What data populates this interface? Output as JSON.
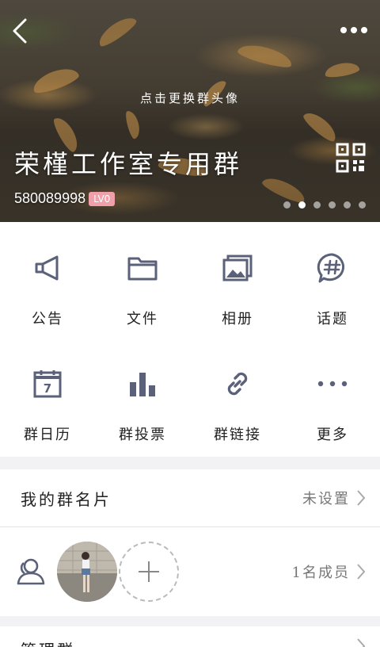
{
  "header": {
    "change_avatar_label": "点击更换群头像",
    "group_name": "荣槿工作室专用群",
    "group_id": "580089998",
    "level_badge": "LV0",
    "more_icon": "more-horizontal-icon",
    "back_icon": "back-arrow-icon",
    "qr_icon": "qr-code-icon",
    "page_dots": 6,
    "active_dot": 1
  },
  "grid": [
    {
      "label": "公告",
      "icon": "announcement-icon"
    },
    {
      "label": "文件",
      "icon": "folder-icon"
    },
    {
      "label": "相册",
      "icon": "album-icon"
    },
    {
      "label": "话题",
      "icon": "topic-icon"
    },
    {
      "label": "群日历",
      "icon": "calendar-icon"
    },
    {
      "label": "群投票",
      "icon": "vote-icon"
    },
    {
      "label": "群链接",
      "icon": "link-icon"
    },
    {
      "label": "更多",
      "icon": "more-icon"
    }
  ],
  "calendar_day": "7",
  "card_row": {
    "title": "我的群名片",
    "value": "未设置"
  },
  "members": {
    "count_label": "1名成员"
  },
  "bottom_row": {
    "title": "管理群"
  },
  "colors": {
    "icon": "#5a6178",
    "badge": "#f0a0aa",
    "background": "#f2f2f4"
  }
}
